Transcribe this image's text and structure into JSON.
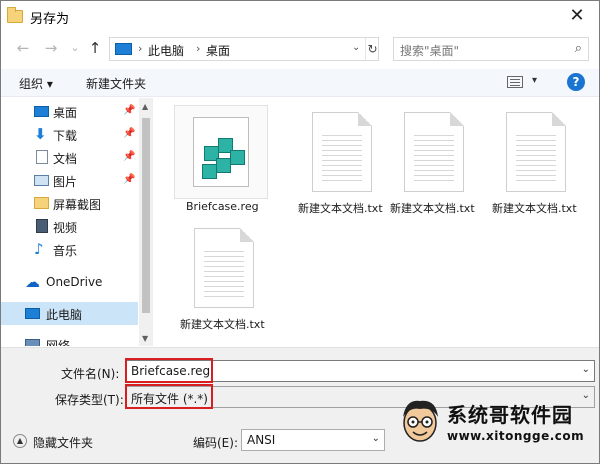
{
  "window": {
    "title": "另存为",
    "close_glyph": "✕"
  },
  "nav": {
    "back_glyph": "←",
    "forward_glyph": "→",
    "recent_glyph": "⌄",
    "up_glyph": "↑",
    "path": [
      "此电脑",
      "桌面"
    ],
    "search_placeholder": "搜索\"桌面\""
  },
  "toolbar": {
    "organize": "组织 ▾",
    "new_folder": "新建文件夹",
    "help": "?"
  },
  "sidebar": {
    "items": [
      {
        "label": "桌面",
        "icon": "desktop-icon",
        "pinned": true
      },
      {
        "label": "下载",
        "icon": "download-icon",
        "pinned": true
      },
      {
        "label": "文档",
        "icon": "documents-icon",
        "pinned": true
      },
      {
        "label": "图片",
        "icon": "pictures-icon",
        "pinned": true
      },
      {
        "label": "屏幕截图",
        "icon": "folder-icon",
        "pinned": false
      },
      {
        "label": "视频",
        "icon": "videos-icon",
        "pinned": false
      },
      {
        "label": "音乐",
        "icon": "music-icon",
        "pinned": false
      },
      {
        "label": "OneDrive",
        "icon": "onedrive-icon",
        "pinned": false
      },
      {
        "label": "此电脑",
        "icon": "pc-icon",
        "pinned": false,
        "selected": true
      },
      {
        "label": "网络",
        "icon": "network-icon",
        "pinned": false
      }
    ]
  },
  "files": [
    {
      "name": "Briefcase.reg",
      "type": "reg"
    },
    {
      "name": "新建文本文档.txt",
      "type": "txt"
    },
    {
      "name": "新建文本文档.txt",
      "type": "txt"
    },
    {
      "name": "新建文本文档.txt",
      "type": "txt"
    },
    {
      "name": "新建文本文档.txt",
      "type": "txt"
    }
  ],
  "save": {
    "filename_label": "文件名(N):",
    "filename_value": "Briefcase.reg",
    "filetype_label": "保存类型(T):",
    "filetype_value": "所有文件  (*.*)",
    "hide_folders": "隐藏文件夹",
    "encoding_label": "编码(E):",
    "encoding_value": "ANSI"
  },
  "watermark": {
    "title": "系统哥软件园",
    "url": "www.xitongge.com"
  },
  "colors": {
    "accent": "#1a74d2",
    "selection": "#cce4f7",
    "highlight_box": "#d81e1e"
  }
}
